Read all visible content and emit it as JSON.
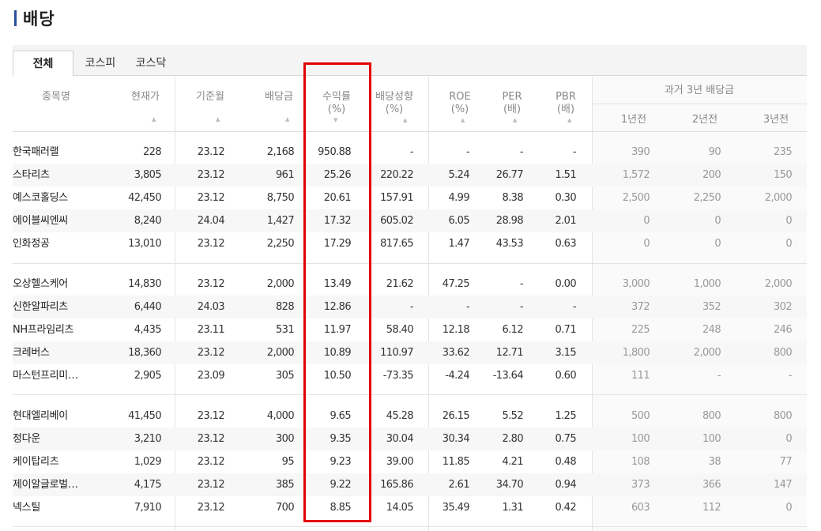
{
  "page": {
    "title": "배당"
  },
  "tabs": [
    {
      "label": "전체",
      "active": true
    },
    {
      "label": "코스피",
      "active": false
    },
    {
      "label": "코스닥",
      "active": false
    }
  ],
  "headers": {
    "name": "종목명",
    "price": "현재가",
    "base_month": "기준월",
    "dividend": "배당금",
    "yield_l1": "수익률",
    "yield_l2": "(%)",
    "payout_l1": "배당성향",
    "payout_l2": "(%)",
    "roe_l1": "ROE",
    "roe_l2": "(%)",
    "per_l1": "PER",
    "per_l2": "(배)",
    "pbr_l1": "PBR",
    "pbr_l2": "(배)",
    "past_title": "과거 3년 배당금",
    "past_1": "1년전",
    "past_2": "2년전",
    "past_3": "3년전"
  },
  "sort_icon": "triangle-up-icon",
  "highlight_color": "#e30000",
  "rows": [
    {
      "name": "한국패러랠",
      "price": "228",
      "month": "23.12",
      "div": "2,168",
      "yield": "950.88",
      "payout": "-",
      "roe": "-",
      "per": "-",
      "pbr": "-",
      "p1": "390",
      "p2": "90",
      "p3": "235"
    },
    {
      "name": "스타리츠",
      "price": "3,805",
      "month": "23.12",
      "div": "961",
      "yield": "25.26",
      "payout": "220.22",
      "roe": "5.24",
      "per": "26.77",
      "pbr": "1.51",
      "p1": "1,572",
      "p2": "200",
      "p3": "150"
    },
    {
      "name": "예스코홀딩스",
      "price": "42,450",
      "month": "23.12",
      "div": "8,750",
      "yield": "20.61",
      "payout": "157.91",
      "roe": "4.99",
      "per": "8.38",
      "pbr": "0.30",
      "p1": "2,500",
      "p2": "2,250",
      "p3": "2,000"
    },
    {
      "name": "에이블씨엔씨",
      "price": "8,240",
      "month": "24.04",
      "div": "1,427",
      "yield": "17.32",
      "payout": "605.02",
      "roe": "6.05",
      "per": "28.98",
      "pbr": "2.01",
      "p1": "0",
      "p2": "0",
      "p3": "0"
    },
    {
      "name": "인화정공",
      "price": "13,010",
      "month": "23.12",
      "div": "2,250",
      "yield": "17.29",
      "payout": "817.65",
      "roe": "1.47",
      "per": "43.53",
      "pbr": "0.63",
      "p1": "0",
      "p2": "0",
      "p3": "0"
    },
    {
      "name": "오상헬스케어",
      "price": "14,830",
      "month": "23.12",
      "div": "2,000",
      "yield": "13.49",
      "payout": "21.62",
      "roe": "47.25",
      "per": "-",
      "pbr": "0.00",
      "p1": "3,000",
      "p2": "1,000",
      "p3": "2,000"
    },
    {
      "name": "신한알파리츠",
      "price": "6,440",
      "month": "24.03",
      "div": "828",
      "yield": "12.86",
      "payout": "-",
      "roe": "-",
      "per": "-",
      "pbr": "-",
      "p1": "372",
      "p2": "352",
      "p3": "302"
    },
    {
      "name": "NH프라임리츠",
      "price": "4,435",
      "month": "23.11",
      "div": "531",
      "yield": "11.97",
      "payout": "58.40",
      "roe": "12.18",
      "per": "6.12",
      "pbr": "0.71",
      "p1": "225",
      "p2": "248",
      "p3": "246"
    },
    {
      "name": "크레버스",
      "price": "18,360",
      "month": "23.12",
      "div": "2,000",
      "yield": "10.89",
      "payout": "110.97",
      "roe": "33.62",
      "per": "12.71",
      "pbr": "3.15",
      "p1": "1,800",
      "p2": "2,000",
      "p3": "800"
    },
    {
      "name": "마스턴프리미…",
      "price": "2,905",
      "month": "23.09",
      "div": "305",
      "yield": "10.50",
      "payout": "-73.35",
      "roe": "-4.24",
      "per": "-13.64",
      "pbr": "0.60",
      "p1": "111",
      "p2": "-",
      "p3": "-"
    },
    {
      "name": "현대엘리베이",
      "price": "41,450",
      "month": "23.12",
      "div": "4,000",
      "yield": "9.65",
      "payout": "45.28",
      "roe": "26.15",
      "per": "5.52",
      "pbr": "1.25",
      "p1": "500",
      "p2": "800",
      "p3": "800"
    },
    {
      "name": "정다운",
      "price": "3,210",
      "month": "23.12",
      "div": "300",
      "yield": "9.35",
      "payout": "30.04",
      "roe": "30.34",
      "per": "2.80",
      "pbr": "0.75",
      "p1": "100",
      "p2": "100",
      "p3": "0"
    },
    {
      "name": "케이탑리츠",
      "price": "1,029",
      "month": "23.12",
      "div": "95",
      "yield": "9.23",
      "payout": "39.00",
      "roe": "11.85",
      "per": "4.21",
      "pbr": "0.48",
      "p1": "108",
      "p2": "38",
      "p3": "77"
    },
    {
      "name": "제이알글로벌…",
      "price": "4,175",
      "month": "23.12",
      "div": "385",
      "yield": "9.22",
      "payout": "165.86",
      "roe": "2.61",
      "per": "34.70",
      "pbr": "0.94",
      "p1": "373",
      "p2": "366",
      "p3": "147"
    },
    {
      "name": "넥스틸",
      "price": "7,910",
      "month": "23.12",
      "div": "700",
      "yield": "8.85",
      "payout": "14.05",
      "roe": "35.49",
      "per": "1.31",
      "pbr": "0.42",
      "p1": "603",
      "p2": "112",
      "p3": "0"
    }
  ]
}
